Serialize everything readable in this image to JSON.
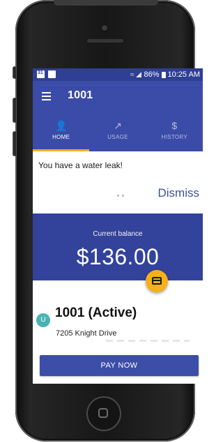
{
  "status_bar": {
    "left_icons": [
      "sim-icon",
      "image-icon"
    ],
    "left_icon_text": "31",
    "battery_percent": "86%",
    "time": "10:25 AM"
  },
  "app_bar": {
    "title": "1001",
    "menu_icon": "menu-icon"
  },
  "tabs": [
    {
      "label": "HOME",
      "icon": "person-icon",
      "glyph": "👤",
      "active": true
    },
    {
      "label": "USAGE",
      "icon": "trend-icon",
      "glyph": "↗",
      "active": false
    },
    {
      "label": "HISTORY",
      "icon": "dollar-icon",
      "glyph": "$",
      "active": false
    }
  ],
  "alert": {
    "message": "You have a water leak!",
    "dismiss_label": "Dismiss"
  },
  "balance": {
    "label": "Current balance",
    "amount": "$136.00"
  },
  "account": {
    "avatar_letter": "U",
    "title": "1001 (Active)",
    "address": "7205 Knight Drive"
  },
  "actions": {
    "pay_label": "PAY NOW"
  },
  "colors": {
    "primary": "#3b4ba8",
    "primary_dark": "#2f3f93",
    "balance_panel": "#33429a",
    "accent": "#f5b118",
    "avatar": "#4ab3b2"
  }
}
